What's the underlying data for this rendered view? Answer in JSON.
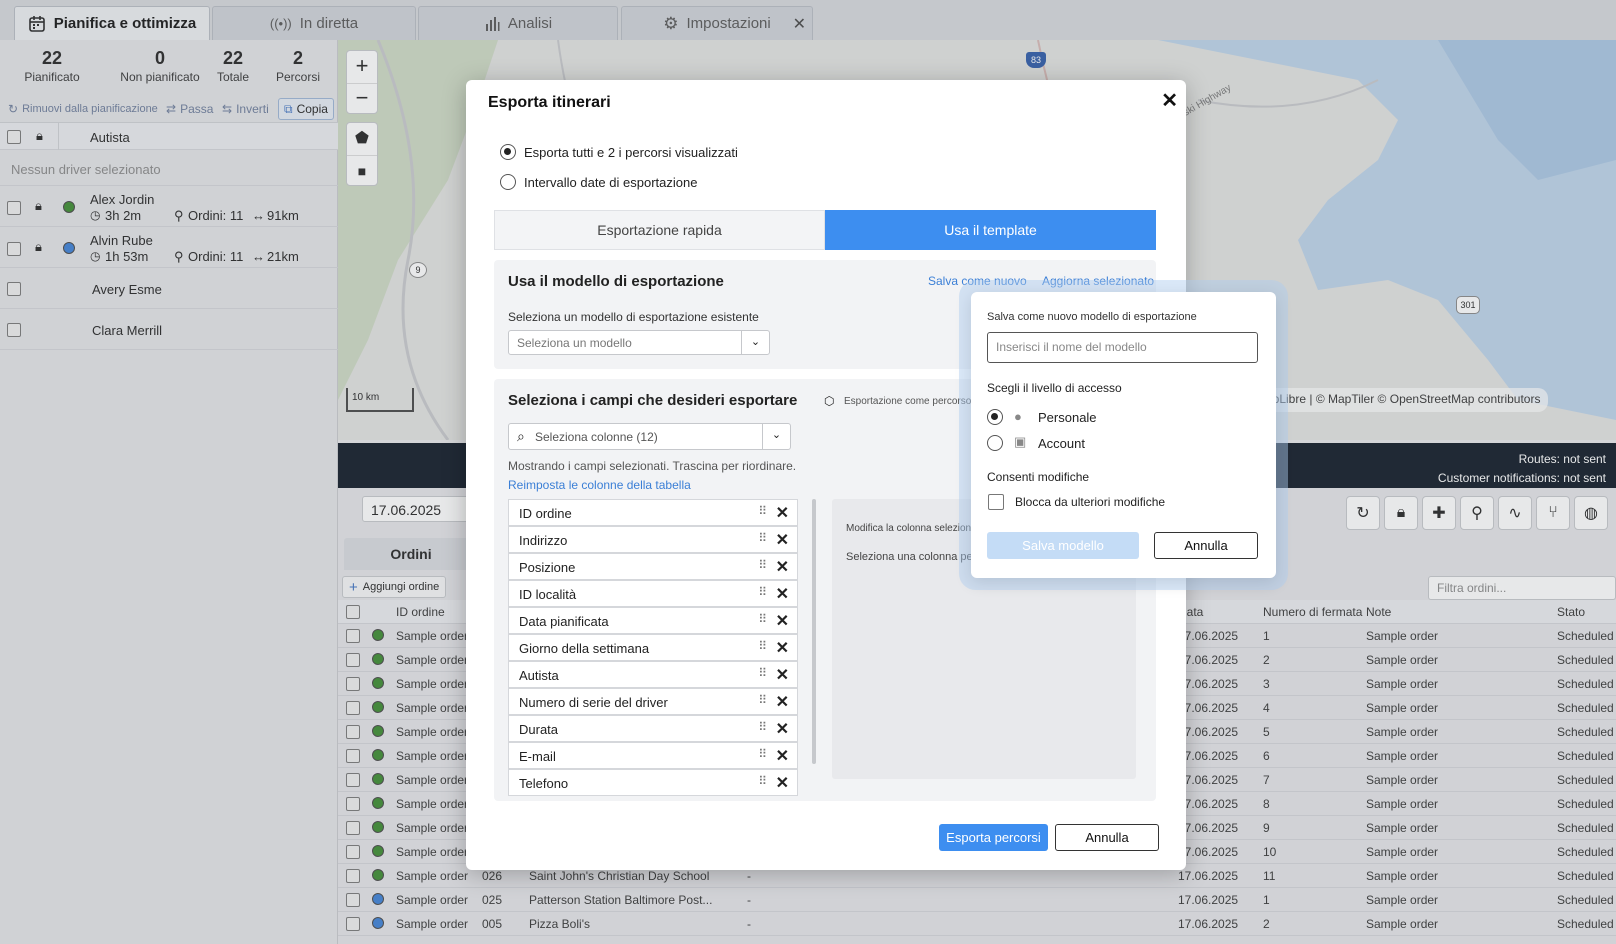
{
  "tabs": [
    {
      "label": "Pianifica e ottimizza",
      "icon": "calendar-icon"
    },
    {
      "label": "In diretta",
      "icon": "broadcast-icon"
    },
    {
      "label": "Analisi",
      "icon": "bar-chart-icon"
    },
    {
      "label": "Impostazioni",
      "icon": "gear-icon"
    }
  ],
  "stats": [
    {
      "value": "22",
      "label": "Pianificato"
    },
    {
      "value": "0",
      "label": "Non pianificato"
    },
    {
      "value": "22",
      "label": "Totale"
    },
    {
      "value": "2",
      "label": "Percorsi"
    }
  ],
  "toolbar": {
    "unplan": "Rimuovi dalla pianificazione",
    "pass": "Passa",
    "invert": "Inverti",
    "copy": "Copia"
  },
  "drivers": {
    "header": "Autista",
    "none_selected": "Nessun driver selezionato",
    "rows": [
      {
        "name": "Alex Jordin",
        "time": "3h 2m",
        "orders": "Ordini: 11",
        "dist": "91km",
        "color": "#3a8a2e"
      },
      {
        "name": "Alvin Rube",
        "time": "1h 53m",
        "orders": "Ordini: 11",
        "dist": "21km",
        "color": "#3b7fd6"
      },
      {
        "name": "Avery Esme"
      },
      {
        "name": "Clara Merrill"
      }
    ]
  },
  "map": {
    "scale": "10 km",
    "attribution": "MapLibre | © MapTiler © OpenStreetMap contributors",
    "road_label": "Pulaski Highway",
    "shields": [
      "83",
      "9",
      "301"
    ]
  },
  "status": {
    "routes": "Routes: not sent",
    "notifications": "Customer notifications: not sent"
  },
  "bottom": {
    "date": "17.06.2025",
    "tab_orders": "Ordini",
    "add_order": "Aggiungi ordine",
    "edit_partial": "M",
    "filter_placeholder": "Filtra ordini...",
    "columns": {
      "id": "ID ordine",
      "date": "Data",
      "stop": "Numero di fermata",
      "note": "Note",
      "status": "Stato"
    },
    "rows": [
      {
        "name": "Sample order",
        "code": "",
        "place": "",
        "dash": "",
        "date": "17.06.2025",
        "stop": "1",
        "note": "Sample order",
        "status": "Scheduled",
        "color": "#3a8a2e"
      },
      {
        "name": "Sample order",
        "code": "",
        "place": "",
        "dash": "",
        "date": "17.06.2025",
        "stop": "2",
        "note": "Sample order",
        "status": "Scheduled",
        "color": "#3a8a2e"
      },
      {
        "name": "Sample order",
        "code": "",
        "place": "",
        "dash": "",
        "date": "17.06.2025",
        "stop": "3",
        "note": "Sample order",
        "status": "Scheduled",
        "color": "#3a8a2e"
      },
      {
        "name": "Sample order",
        "code": "",
        "place": "",
        "dash": "",
        "date": "17.06.2025",
        "stop": "4",
        "note": "Sample order",
        "status": "Scheduled",
        "color": "#3a8a2e"
      },
      {
        "name": "Sample order",
        "code": "",
        "place": "",
        "dash": "",
        "date": "17.06.2025",
        "stop": "5",
        "note": "Sample order",
        "status": "Scheduled",
        "color": "#3a8a2e"
      },
      {
        "name": "Sample order",
        "code": "",
        "place": "",
        "dash": "",
        "date": "17.06.2025",
        "stop": "6",
        "note": "Sample order",
        "status": "Scheduled",
        "color": "#3a8a2e"
      },
      {
        "name": "Sample order",
        "code": "",
        "place": "",
        "dash": "",
        "date": "17.06.2025",
        "stop": "7",
        "note": "Sample order",
        "status": "Scheduled",
        "color": "#3a8a2e"
      },
      {
        "name": "Sample order",
        "code": "",
        "place": "",
        "dash": "",
        "date": "17.06.2025",
        "stop": "8",
        "note": "Sample order",
        "status": "Scheduled",
        "color": "#3a8a2e"
      },
      {
        "name": "Sample order",
        "code": "",
        "place": "",
        "dash": "",
        "date": "17.06.2025",
        "stop": "9",
        "note": "Sample order",
        "status": "Scheduled",
        "color": "#3a8a2e"
      },
      {
        "name": "Sample order",
        "code": "",
        "place": "",
        "dash": "",
        "date": "17.06.2025",
        "stop": "10",
        "note": "Sample order",
        "status": "Scheduled",
        "color": "#3a8a2e"
      },
      {
        "name": "Sample order",
        "code": "026",
        "place": "Saint John's Christian Day School",
        "dash": "-",
        "date": "17.06.2025",
        "stop": "11",
        "note": "Sample order",
        "status": "Scheduled",
        "color": "#3a8a2e"
      },
      {
        "name": "Sample order",
        "code": "025",
        "place": "Patterson Station Baltimore Post...",
        "dash": "-",
        "date": "17.06.2025",
        "stop": "1",
        "note": "Sample order",
        "status": "Scheduled",
        "color": "#3b7fd6"
      },
      {
        "name": "Sample order",
        "code": "005",
        "place": "Pizza Boli's",
        "dash": "-",
        "date": "17.06.2025",
        "stop": "2",
        "note": "Sample order",
        "status": "Scheduled",
        "color": "#3b7fd6"
      }
    ]
  },
  "modal": {
    "title": "Esporta itinerari",
    "option_all": "Esporta tutti e 2 i percorsi visualizzati",
    "option_range": "Intervallo date di esportazione",
    "seg_quick": "Esportazione rapida",
    "seg_template": "Usa il template",
    "template_title": "Usa il modello di esportazione",
    "save_new": "Salva come nuovo",
    "update_selected": "Aggiorna selezionato",
    "select_existing_label": "Seleziona un modello di esportazione esistente",
    "select_model_placeholder": "Seleziona un modello",
    "fields_title": "Seleziona i campi che desideri esportare",
    "export_as_route": "Esportazione come percorso",
    "columns_select": "Seleziona colonne (12)",
    "hint": "Mostrando i campi selezionati. Trascina per riordinare.",
    "reset_link": "Reimposta le colonne della tabella",
    "fields": [
      "ID ordine",
      "Indirizzo",
      "Posizione",
      "ID località",
      "Data pianificata",
      "Giorno della settimana",
      "Autista",
      "Numero di serie del driver",
      "Durata",
      "E-mail",
      "Telefono"
    ],
    "edit_column_hint": "Modifica la colonna selezionata",
    "select_column_hint": "Seleziona una colonna per",
    "export_button": "Esporta percorsi",
    "cancel_button": "Annulla"
  },
  "popover": {
    "label": "Salva come nuovo modello di esportazione",
    "name_placeholder": "Inserisci il nome del modello",
    "access_title": "Scegli il livello di accesso",
    "personal": "Personale",
    "account": "Account",
    "allow_edits_title": "Consenti modifiche",
    "lock_label": "Blocca da ulteriori modifiche",
    "save_button": "Salva modello",
    "cancel_button": "Annulla"
  }
}
